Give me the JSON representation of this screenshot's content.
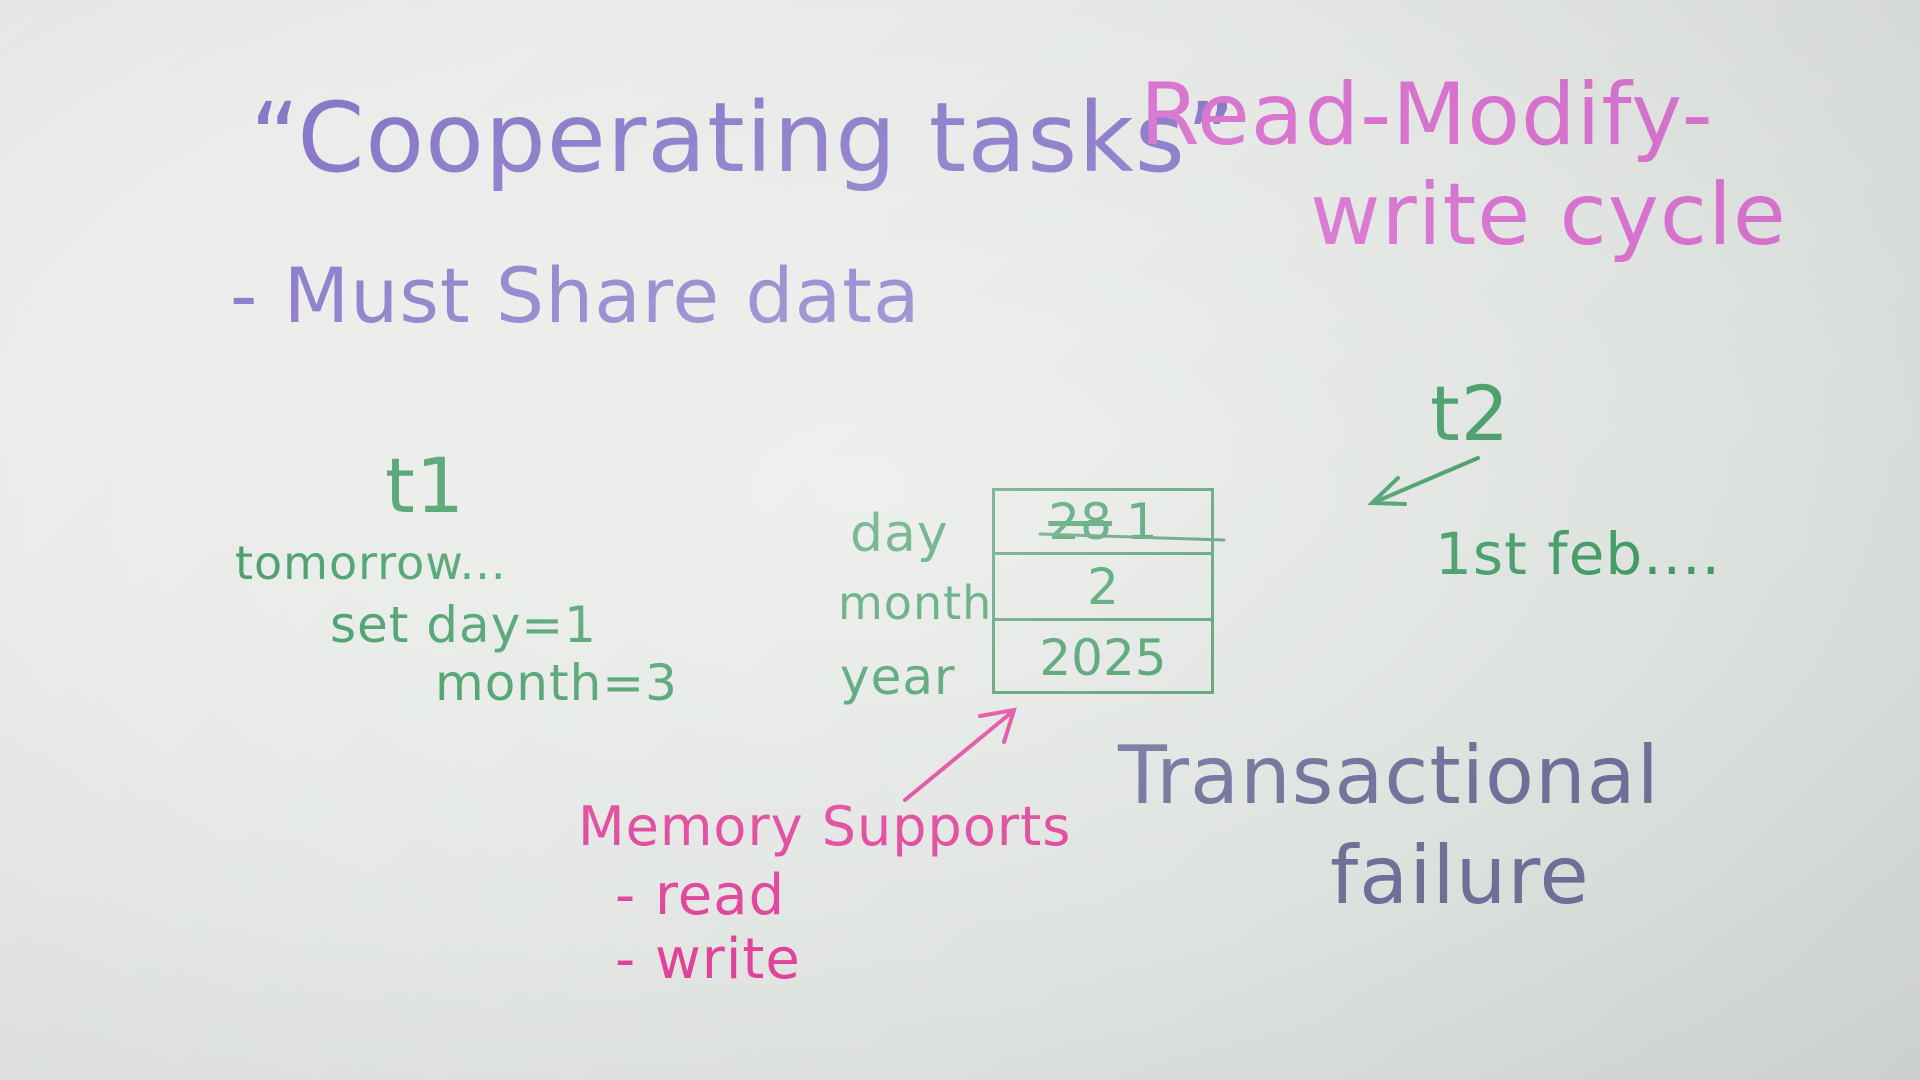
{
  "board": {
    "title": "“Cooperating tasks”",
    "bullet": "- Must Share data",
    "rmw_line1": "Read-Modify-",
    "rmw_line2": "write cycle"
  },
  "task1": {
    "label": "t1",
    "line1": "tomorrow...",
    "line2": "set day=1",
    "line3": "month=3"
  },
  "task2": {
    "label": "t2",
    "text": "1st feb...."
  },
  "memory": {
    "row_labels": {
      "day": "day",
      "month": "month",
      "year": "year"
    },
    "values": {
      "day_old": "28",
      "day_new": "1",
      "month": "2",
      "year": "2025"
    },
    "heading": "Memory Supports",
    "op_read": "- read",
    "op_write": "- write"
  },
  "failure": {
    "line1": "Transactional",
    "line2": "failure"
  },
  "colors": {
    "purple_ink": "#8a78c8",
    "pink_ink": "#d873cf",
    "hotpink_ink": "#e0439a",
    "green_ink": "#3f9a63",
    "gray_ink": "#6f6f98"
  }
}
